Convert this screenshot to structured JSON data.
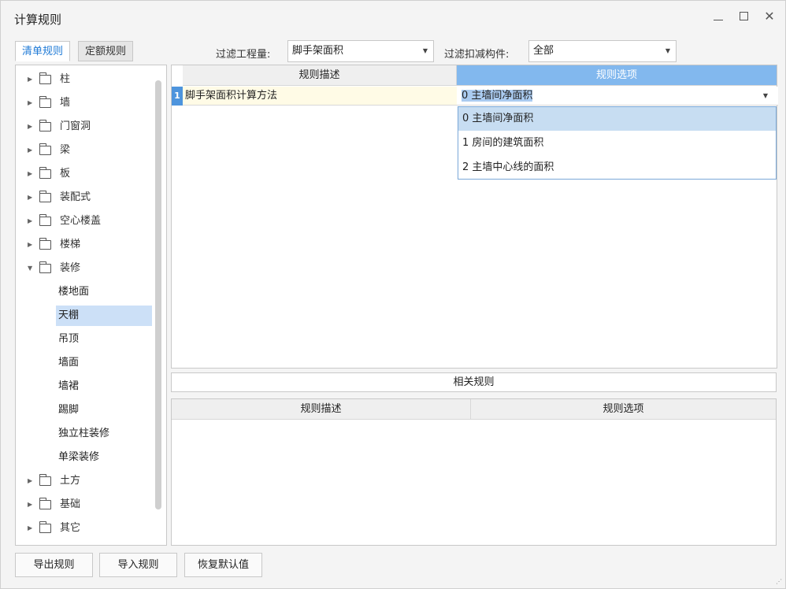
{
  "window": {
    "title": "计算规则",
    "min_label": "",
    "max_label": "",
    "close_label": "✕"
  },
  "tabs": [
    {
      "label": "清单规则",
      "active": true
    },
    {
      "label": "定额规则",
      "active": false
    }
  ],
  "filters": {
    "quantity_label": "过滤工程量:",
    "quantity_value": "脚手架面积",
    "deduct_label": "过滤扣减构件:",
    "deduct_value": "全部"
  },
  "tree": {
    "items": [
      {
        "label": "柱",
        "expanded": false
      },
      {
        "label": "墙",
        "expanded": false
      },
      {
        "label": "门窗洞",
        "expanded": false
      },
      {
        "label": "梁",
        "expanded": false
      },
      {
        "label": "板",
        "expanded": false
      },
      {
        "label": "装配式",
        "expanded": false
      },
      {
        "label": "空心楼盖",
        "expanded": false
      },
      {
        "label": "楼梯",
        "expanded": false
      },
      {
        "label": "装修",
        "expanded": true
      },
      {
        "label": "土方",
        "expanded": false
      },
      {
        "label": "基础",
        "expanded": false
      },
      {
        "label": "其它",
        "expanded": false
      }
    ],
    "children": [
      {
        "label": "楼地面",
        "selected": false
      },
      {
        "label": "天棚",
        "selected": true
      },
      {
        "label": "吊顶",
        "selected": false
      },
      {
        "label": "墙面",
        "selected": false
      },
      {
        "label": "墙裙",
        "selected": false
      },
      {
        "label": "踢脚",
        "selected": false
      },
      {
        "label": "独立柱装修",
        "selected": false
      },
      {
        "label": "单梁装修",
        "selected": false
      }
    ]
  },
  "grid": {
    "col_desc": "规则描述",
    "col_option": "规则选项",
    "row_number": "1",
    "row_desc": "脚手架面积计算方法",
    "row_value": "0 主墙间净面积"
  },
  "dropdown": {
    "options": [
      {
        "label": "0 主墙间净面积",
        "highlighted": true
      },
      {
        "label": "1 房间的建筑面积",
        "highlighted": false
      },
      {
        "label": "2 主墙中心线的面积",
        "highlighted": false
      }
    ]
  },
  "related": {
    "title": "相关规则",
    "col_desc": "规则描述",
    "col_option": "规则选项"
  },
  "buttons": {
    "export": "导出规则",
    "import": "导入规则",
    "restore": "恢复默认值"
  }
}
